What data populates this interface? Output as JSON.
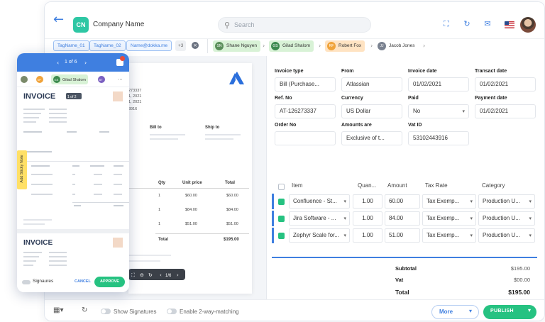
{
  "header": {
    "logo_initials": "CN",
    "company_name": "Company Name",
    "search_placeholder": "Search"
  },
  "tags": [
    "TagName_01",
    "TagName_02",
    "Name@dokka.me"
  ],
  "tags_more": "+3",
  "approvers": [
    {
      "initials": "SN",
      "name": "Shane Nguyen",
      "color": "#d8f2d6",
      "avatar": "#5a8f5a"
    },
    {
      "initials": "GS",
      "name": "Gilad Shalom",
      "color": "#d8f2d6",
      "avatar": "#3c8a4e"
    },
    {
      "initials": "RF",
      "name": "Robert Fox",
      "color": "#ffe3c2",
      "avatar": "#f0a33a"
    },
    {
      "initials": "JJ",
      "name": "Jacob Jones",
      "color": "#ffffff",
      "avatar": "#7a8290"
    }
  ],
  "form": {
    "invoice_type": {
      "label": "Invoice type",
      "value": "Bill (Purchase..."
    },
    "from": {
      "label": "From",
      "value": "Atlassian"
    },
    "invoice_date": {
      "label": "Invoice date",
      "value": "01/02/2021"
    },
    "transact_date": {
      "label": "Transact date",
      "value": "01/02/2021"
    },
    "ref_no": {
      "label": "Ref. No",
      "value": "AT-126273337"
    },
    "currency": {
      "label": "Currency",
      "value": "US Dollar"
    },
    "paid": {
      "label": "Paid",
      "value": "No"
    },
    "payment_date": {
      "label": "Payment date",
      "value": "01/02/2021"
    },
    "order_no": {
      "label": "Order No",
      "value": ""
    },
    "amounts_are": {
      "label": "Amounts are",
      "value": "Exclusive of t..."
    },
    "vat_id": {
      "label": "Vat ID",
      "value": "53102443916"
    }
  },
  "table": {
    "headers": {
      "item": "Item",
      "quantity": "Quan...",
      "amount": "Amount",
      "tax_rate": "Tax Rate",
      "category": "Category"
    },
    "rows": [
      {
        "item": "Confluence - St...",
        "quantity": "1.00",
        "amount": "60.00",
        "tax": "Tax Exemp...",
        "category": "Production U..."
      },
      {
        "item": "Jira Software - ...",
        "quantity": "1.00",
        "amount": "84.00",
        "tax": "Tax Exemp...",
        "category": "Production U..."
      },
      {
        "item": "Zephyr Scale for...",
        "quantity": "1.00",
        "amount": "51.00",
        "tax": "Tax Exemp...",
        "category": "Production U..."
      }
    ]
  },
  "totals": {
    "subtotal_label": "Subtotal",
    "subtotal": "$195.00",
    "vat_label": "Vat",
    "vat": "$00.00",
    "total_label": "Total",
    "total": "$195.00"
  },
  "doc": {
    "ref_lines": [
      "273337",
      "1, 2021",
      "1, 2021",
      "3916"
    ],
    "bill_to": "Bill to",
    "ship_to": "Ship to",
    "cols": {
      "qty": "Qty",
      "unit_price": "Unit price",
      "total": "Total"
    },
    "rows": [
      {
        "qty": "1",
        "price": "$60.00",
        "total": "$60.00"
      },
      {
        "qty": "1",
        "price": "$84.00",
        "total": "$84.00"
      },
      {
        "qty": "1",
        "price": "$51.00",
        "total": "$51.00"
      }
    ],
    "total_label": "Total",
    "total_value": "$195.00",
    "page_indicator": "1/6"
  },
  "bottom": {
    "show_signatures": "Show Signatures",
    "two_way": "Enable 2-way-matching",
    "more": "More",
    "publish": "PUBLISH"
  },
  "mobile": {
    "page": "1 of 6",
    "approver": "Gilad Shalom",
    "approver_initials": [
      "GS",
      "SP",
      "BT"
    ],
    "page_badge": "1 of 2",
    "invoice_title": "INVOICE",
    "sticky_note": "Add Sticky Note",
    "signatures": "Signaures",
    "cancel": "CANCEL",
    "approve": "APPROVE"
  }
}
